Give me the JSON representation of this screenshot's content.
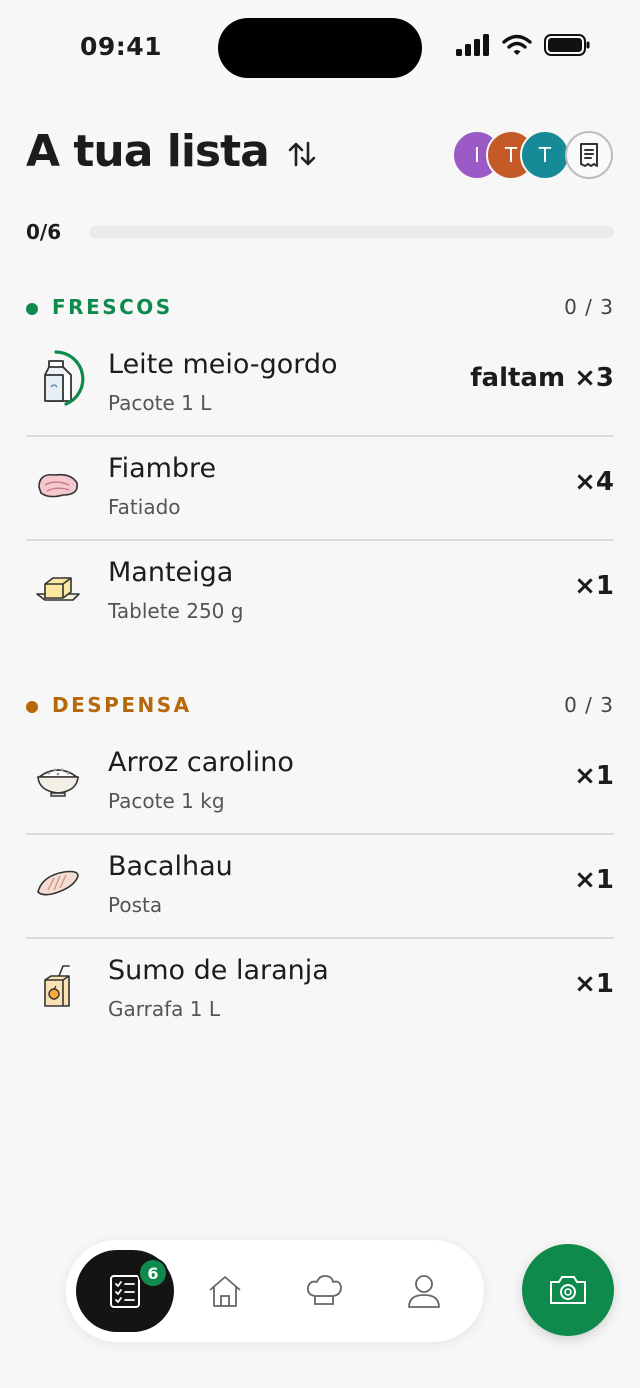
{
  "status_bar": {
    "time": "09:41"
  },
  "header": {
    "title": "A tua lista",
    "avatars": [
      {
        "initial": "I",
        "color": "#9b59c6"
      },
      {
        "initial": "T",
        "color": "#c45a27"
      },
      {
        "initial": "T",
        "color": "#168a96"
      }
    ]
  },
  "progress": {
    "label": "0/6",
    "fraction": 0
  },
  "sections": [
    {
      "title": "FRESCOS",
      "count": "0 / 3",
      "color": "#0e8a4d",
      "items": [
        {
          "name": "Leite meio-gordo",
          "sub": "Pacote 1 L",
          "qty": "faltam ×3",
          "icon": "milk-carton-icon"
        },
        {
          "name": "Fiambre",
          "sub": "Fatiado",
          "qty": "×4",
          "icon": "ham-icon"
        },
        {
          "name": "Manteiga",
          "sub": "Tablete 250 g",
          "qty": "×1",
          "icon": "butter-icon"
        }
      ]
    },
    {
      "title": "DESPENSA",
      "count": "0 / 3",
      "color": "#b5690a",
      "items": [
        {
          "name": "Arroz carolino",
          "sub": "Pacote 1 kg",
          "qty": "×1",
          "icon": "rice-bowl-icon"
        },
        {
          "name": "Bacalhau",
          "sub": "Posta",
          "qty": "×1",
          "icon": "fish-icon"
        },
        {
          "name": "Sumo de laranja",
          "sub": "Garrafa 1 L",
          "qty": "×1",
          "icon": "juice-box-icon"
        }
      ]
    }
  ],
  "nav": {
    "badge": "6"
  },
  "colors": {
    "accent": "#0e8a4d",
    "dark": "#141414"
  }
}
